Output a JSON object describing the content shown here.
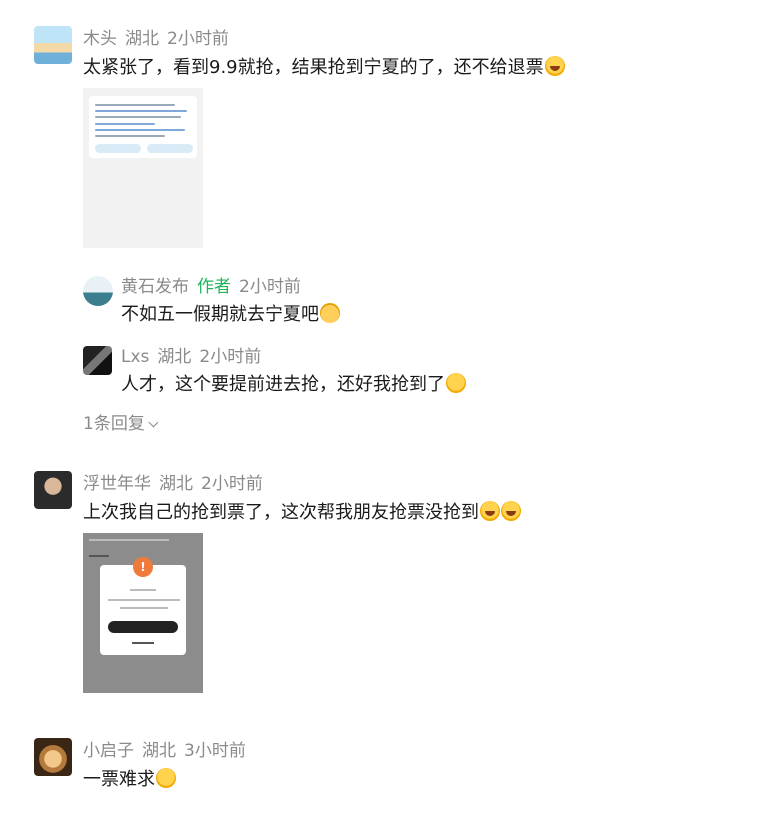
{
  "comments": [
    {
      "name": "木头",
      "location": "湖北",
      "time": "2小时前",
      "text": "太紧张了，看到9.9就抢，结果抢到宁夏的了，还不给退票",
      "emoji": "laugh-cry-emoji",
      "replies": [
        {
          "name": "黄石发布",
          "tag": "作者",
          "time": "2小时前",
          "text": "不如五一假期就去宁夏吧",
          "emoji": "cat-emoji"
        },
        {
          "name": "Lxs",
          "location": "湖北",
          "time": "2小时前",
          "text": "人才，这个要提前进去抢，还好我抢到了",
          "emoji": "thinking-emoji"
        }
      ],
      "more_replies": "1条回复"
    },
    {
      "name": "浮世年华",
      "location": "湖北",
      "time": "2小时前",
      "text": "上次我自己的抢到票了，这次帮我朋友抢票没抢到",
      "emoji": "laugh-cry-emoji"
    },
    {
      "name": "小启子",
      "location": "湖北",
      "time": "3小时前",
      "text": "一票难求",
      "emoji": "flushed-emoji"
    }
  ],
  "colors": {
    "meta": "#8a8a8a",
    "author_tag": "#1fb55b",
    "text": "#1a1a1a"
  }
}
